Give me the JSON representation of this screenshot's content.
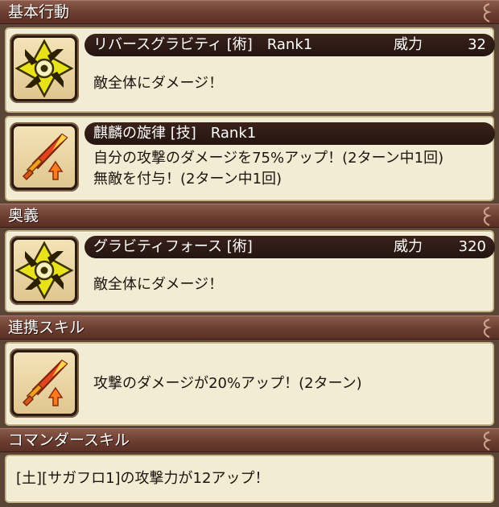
{
  "sections": {
    "basic": {
      "title": "基本行動"
    },
    "ougi": {
      "title": "奥義"
    },
    "link": {
      "title": "連携スキル"
    },
    "commander": {
      "title": "コマンダースキル"
    }
  },
  "basic_skills": [
    {
      "icon": "shuriken-icon",
      "name": "リバースグラビティ [術]　Rank1",
      "power_label": "威力",
      "power_value": "32",
      "desc_lines": [
        "敵全体にダメージ！"
      ]
    },
    {
      "icon": "sword-attack-up-icon",
      "name": "麒麟の旋律 [技]　Rank1",
      "desc_lines": [
        "自分の攻撃のダメージを75%アップ！(2ターン中1回)",
        "無敵を付与！(2ターン中1回)"
      ]
    }
  ],
  "ougi_skill": {
    "icon": "shuriken-icon",
    "name": "グラビティフォース [術]",
    "power_label": "威力",
    "power_value": "320",
    "desc_lines": [
      "敵全体にダメージ！"
    ]
  },
  "link_skill": {
    "icon": "sword-attack-up-icon",
    "desc_lines": [
      "攻撃のダメージが20%アップ！(2ターン)"
    ]
  },
  "commander_skill": {
    "desc_lines": [
      "[土][サガフロ1]の攻撃力が12アップ！"
    ]
  },
  "colors": {
    "header_bg": "#6b3d30",
    "card_bg": "#f3ecd4",
    "name_bar_bg": "#241510",
    "icon_yellow": "#e8e21a",
    "sword_red": "#e0451e"
  }
}
